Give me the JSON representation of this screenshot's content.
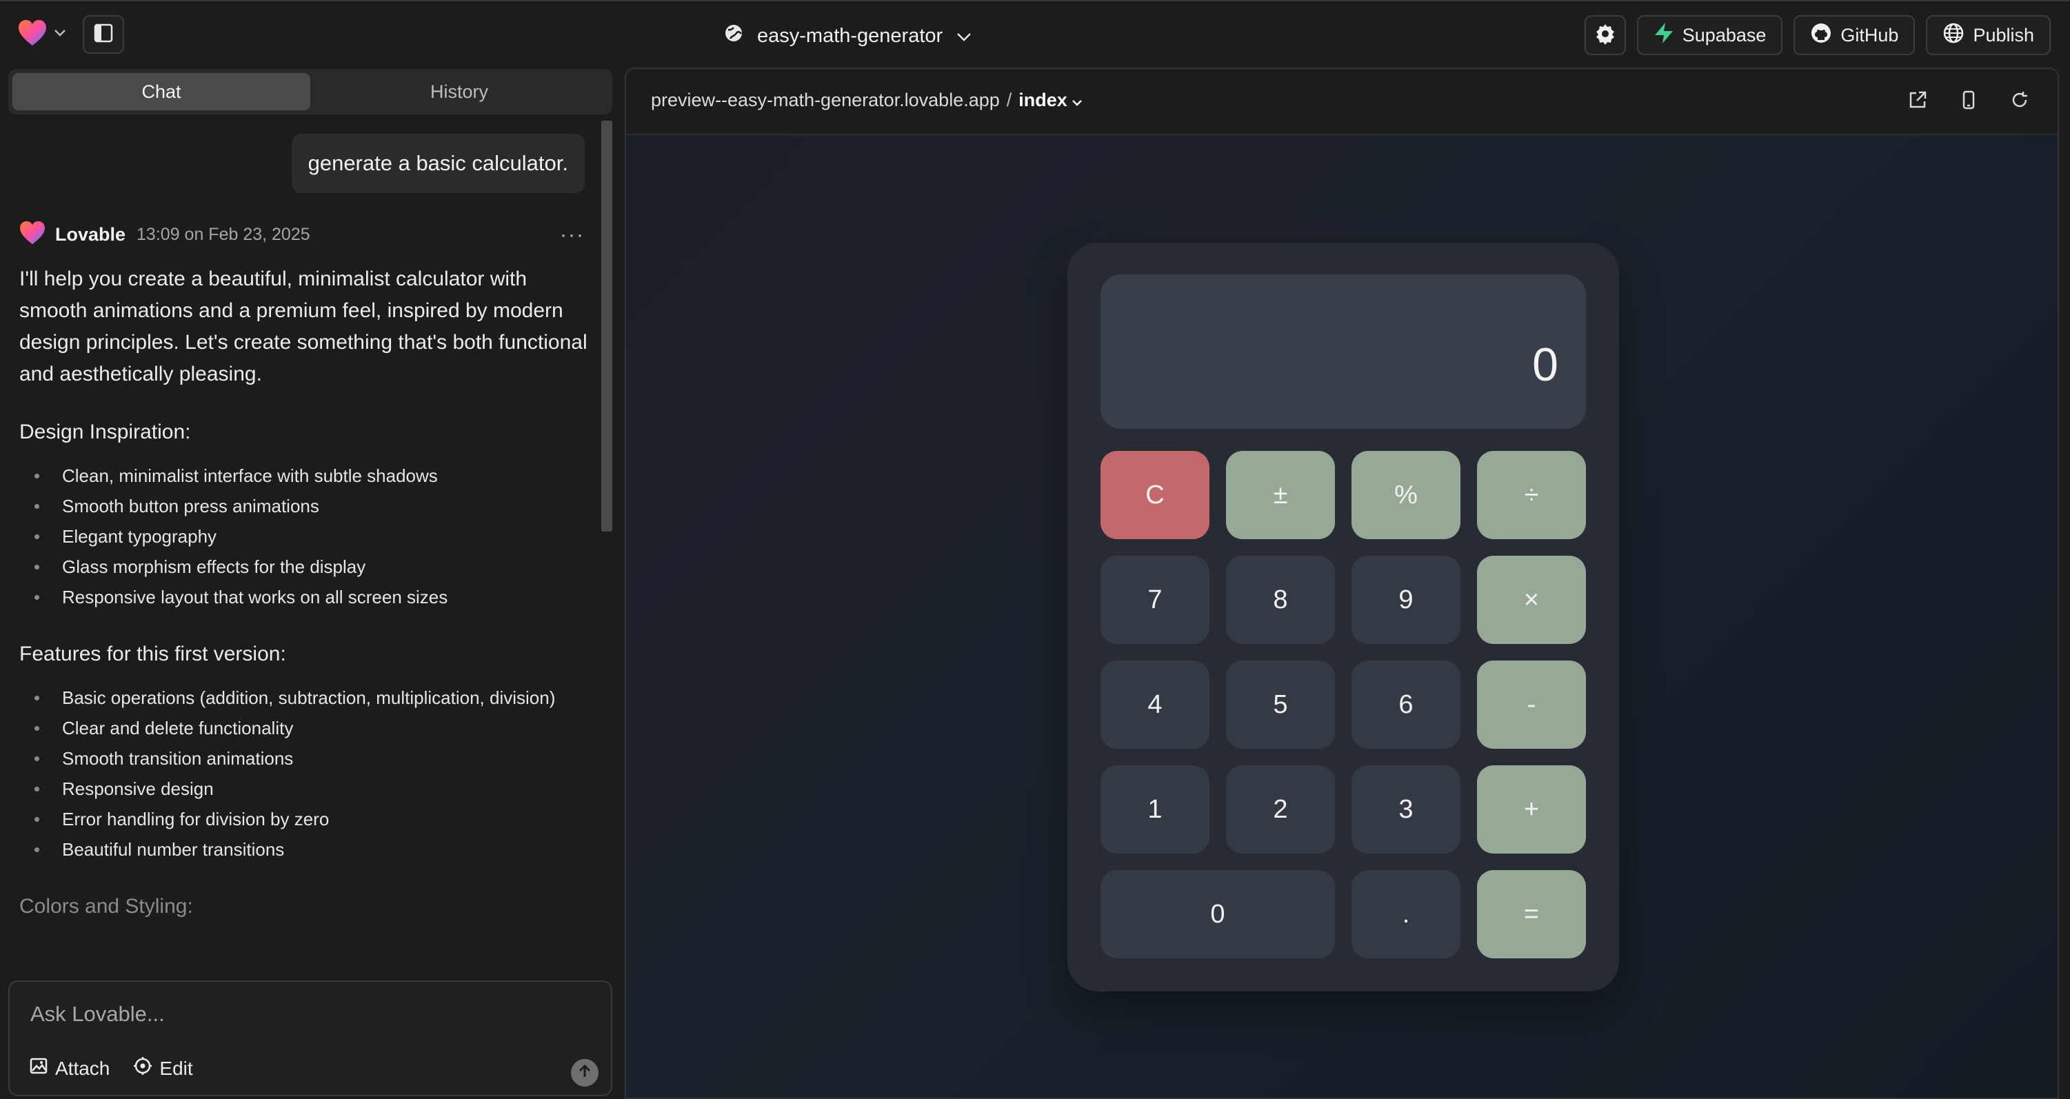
{
  "colors": {
    "background": "#1c1c1c",
    "panel": "#2a2a2a",
    "calc_body": "#272b33",
    "calc_key": "#343a43",
    "calc_operator": "#97a896",
    "calc_clear": "#c5686b",
    "accent_supabase": "#3ecf8e"
  },
  "header": {
    "logo_icon": "heart-logo-icon",
    "project_name": "easy-math-generator",
    "buttons": {
      "settings_icon": "gear-icon",
      "supabase": "Supabase",
      "github": "GitHub",
      "publish": "Publish"
    }
  },
  "sidebar": {
    "tabs": [
      {
        "label": "Chat",
        "active": true
      },
      {
        "label": "History",
        "active": false
      }
    ],
    "user_message": "generate a basic calculator.",
    "assistant": {
      "name": "Lovable",
      "timestamp": "13:09 on Feb 23, 2025",
      "intro": "I'll help you create a beautiful, minimalist calculator with smooth animations and a premium feel, inspired by modern design principles. Let's create something that's both functional and aesthetically pleasing.",
      "design_heading": "Design Inspiration:",
      "design_items": [
        "Clean, minimalist interface with subtle shadows",
        "Smooth button press animations",
        "Elegant typography",
        "Glass morphism effects for the display",
        "Responsive layout that works on all screen sizes"
      ],
      "features_heading": "Features for this first version:",
      "feature_items": [
        "Basic operations (addition, subtraction, multiplication, division)",
        "Clear and delete functionality",
        "Smooth transition animations",
        "Responsive design",
        "Error handling for division by zero",
        "Beautiful number transitions"
      ],
      "colors_heading": "Colors and Styling:"
    },
    "composer": {
      "placeholder": "Ask Lovable...",
      "attach": "Attach",
      "edit": "Edit"
    }
  },
  "preview": {
    "url": "preview--easy-math-generator.lovable.app",
    "separator": "/",
    "route": "index",
    "calculator": {
      "display": "0",
      "keys": [
        {
          "label": "C",
          "kind": "clear"
        },
        {
          "label": "±",
          "kind": "op"
        },
        {
          "label": "%",
          "kind": "op"
        },
        {
          "label": "÷",
          "kind": "op"
        },
        {
          "label": "7",
          "kind": "num"
        },
        {
          "label": "8",
          "kind": "num"
        },
        {
          "label": "9",
          "kind": "num"
        },
        {
          "label": "×",
          "kind": "op"
        },
        {
          "label": "4",
          "kind": "num"
        },
        {
          "label": "5",
          "kind": "num"
        },
        {
          "label": "6",
          "kind": "num"
        },
        {
          "label": "-",
          "kind": "op"
        },
        {
          "label": "1",
          "kind": "num"
        },
        {
          "label": "2",
          "kind": "num"
        },
        {
          "label": "3",
          "kind": "num"
        },
        {
          "label": "+",
          "kind": "op"
        },
        {
          "label": "0",
          "kind": "zero"
        },
        {
          "label": ".",
          "kind": "num"
        },
        {
          "label": "=",
          "kind": "op"
        }
      ]
    }
  }
}
